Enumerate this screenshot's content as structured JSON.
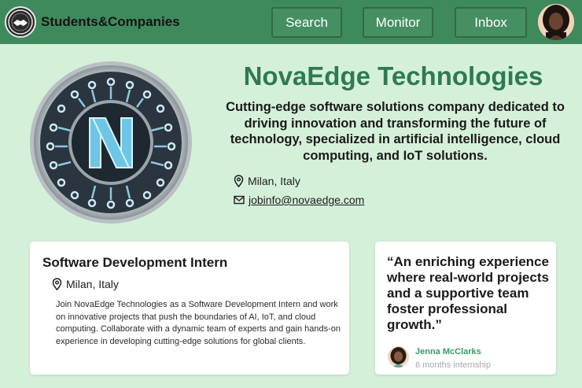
{
  "header": {
    "brand": "Students&Companies",
    "nav": {
      "search": "Search",
      "monitor": "Monitor",
      "inbox": "Inbox"
    }
  },
  "company": {
    "name": "NovaEdge Technologies",
    "description": "Cutting-edge software solutions company dedicated to driving innovation and transforming the future of technology, specialized in artificial intelligence, cloud computing, and IoT solutions.",
    "location": "Milan, Italy",
    "email": "jobinfo@novaedge.com",
    "logo_letter": "N"
  },
  "job": {
    "title": "Software Development Intern",
    "location": "Milan, Italy",
    "description": "Join NovaEdge Technologies as a Software Development Intern and work on innovative projects that push the boundaries of AI, IoT, and cloud computing. Collaborate with a dynamic team of experts and gain hands-on experience in developing cutting-edge solutions for global clients."
  },
  "review": {
    "quote": "“An enriching experience where real-world projects and a supportive team foster professional growth.”",
    "name": "Jenna McClarks",
    "role": "6 months internship"
  },
  "colors": {
    "header_bg": "#3f8a5c",
    "page_bg": "#d5f0d9",
    "accent": "#2e7a52"
  }
}
